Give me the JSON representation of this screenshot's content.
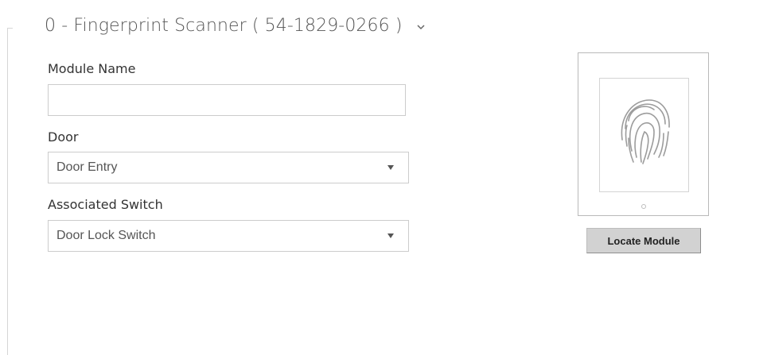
{
  "module": {
    "title": "0 - Fingerprint Scanner ( 54-1829-0266 )",
    "chevron_icon": "chevron-down-icon"
  },
  "form": {
    "module_name": {
      "label": "Module Name",
      "value": "",
      "placeholder": ""
    },
    "door": {
      "label": "Door",
      "selected": "Door Entry",
      "arrow_icon": "dropdown-arrow-icon"
    },
    "associated_switch": {
      "label": "Associated Switch",
      "selected": "Door Lock Switch",
      "arrow_icon": "dropdown-arrow-icon"
    }
  },
  "device": {
    "image_icon": "fingerprint-scanner-module-image",
    "locate_label": "Locate Module"
  },
  "colors": {
    "border": "#cccccc",
    "button_bg": "#d2d2d2",
    "text": "#333333",
    "title": "#555555"
  }
}
